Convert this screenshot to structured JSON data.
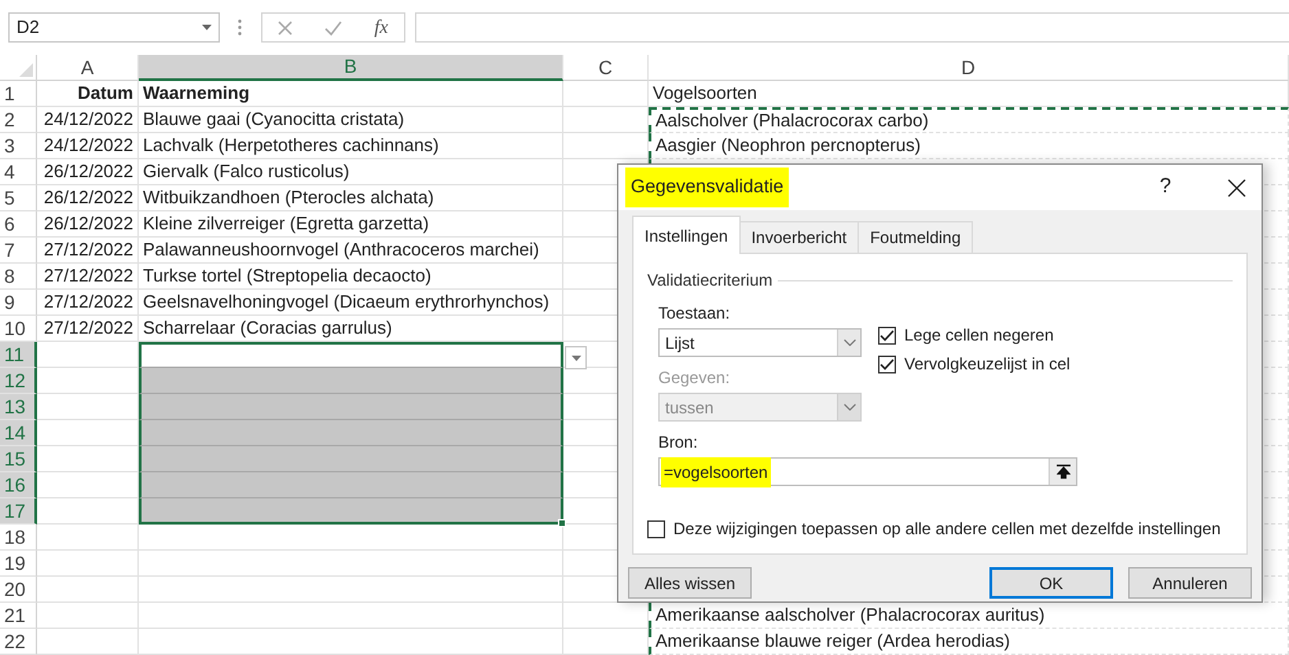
{
  "name_box": {
    "value": "D2"
  },
  "formula_bar": {
    "function_icon": "fx"
  },
  "columns": [
    {
      "label": "A",
      "selected": false
    },
    {
      "label": "B",
      "selected": true
    },
    {
      "label": "C",
      "selected": false
    },
    {
      "label": "D",
      "selected": false
    }
  ],
  "validation_dropdown": true,
  "rows": [
    {
      "number": "1",
      "selected": false,
      "cells": [
        {
          "selected": false,
          "active": false,
          "in_copy_range": false,
          "text": "Datum",
          "bold": true,
          "kind": "date"
        },
        {
          "selected": false,
          "active": false,
          "in_copy_range": false,
          "text": "Waarneming",
          "bold": true,
          "kind": "text"
        },
        {
          "selected": false,
          "active": false,
          "in_copy_range": false
        },
        {
          "selected": false,
          "active": false,
          "in_copy_range": false,
          "text": "Vogelsoorten",
          "bold": false,
          "kind": "text"
        }
      ]
    },
    {
      "number": "2",
      "selected": false,
      "cells": [
        {
          "selected": false,
          "active": false,
          "in_copy_range": false,
          "text": "24/12/2022",
          "bold": false,
          "kind": "date"
        },
        {
          "selected": false,
          "active": false,
          "in_copy_range": false,
          "text": "Blauwe gaai (Cyanocitta cristata)",
          "bold": false,
          "kind": "text"
        },
        {
          "selected": false,
          "active": false,
          "in_copy_range": false
        },
        {
          "selected": false,
          "active": false,
          "in_copy_range": true,
          "text": "Aalscholver (Phalacrocorax carbo)",
          "bold": false,
          "kind": "text"
        }
      ]
    },
    {
      "number": "3",
      "selected": false,
      "cells": [
        {
          "selected": false,
          "active": false,
          "in_copy_range": false,
          "text": "24/12/2022",
          "bold": false,
          "kind": "date"
        },
        {
          "selected": false,
          "active": false,
          "in_copy_range": false,
          "text": "Lachvalk (Herpetotheres cachinnans)",
          "bold": false,
          "kind": "text"
        },
        {
          "selected": false,
          "active": false,
          "in_copy_range": false
        },
        {
          "selected": false,
          "active": false,
          "in_copy_range": true,
          "text": "Aasgier (Neophron percnopterus)",
          "bold": false,
          "kind": "text"
        }
      ]
    },
    {
      "number": "4",
      "selected": false,
      "cells": [
        {
          "selected": false,
          "active": false,
          "in_copy_range": false,
          "text": "26/12/2022",
          "bold": false,
          "kind": "date"
        },
        {
          "selected": false,
          "active": false,
          "in_copy_range": false,
          "text": "Giervalk (Falco rusticolus)",
          "bold": false,
          "kind": "text"
        },
        {
          "selected": false,
          "active": false,
          "in_copy_range": false
        },
        {
          "selected": false,
          "active": false,
          "in_copy_range": true
        }
      ]
    },
    {
      "number": "5",
      "selected": false,
      "cells": [
        {
          "selected": false,
          "active": false,
          "in_copy_range": false,
          "text": "26/12/2022",
          "bold": false,
          "kind": "date"
        },
        {
          "selected": false,
          "active": false,
          "in_copy_range": false,
          "text": "Witbuikzandhoen (Pterocles alchata)",
          "bold": false,
          "kind": "text"
        },
        {
          "selected": false,
          "active": false,
          "in_copy_range": false
        },
        {
          "selected": false,
          "active": false,
          "in_copy_range": true
        }
      ]
    },
    {
      "number": "6",
      "selected": false,
      "cells": [
        {
          "selected": false,
          "active": false,
          "in_copy_range": false,
          "text": "26/12/2022",
          "bold": false,
          "kind": "date"
        },
        {
          "selected": false,
          "active": false,
          "in_copy_range": false,
          "text": "Kleine zilverreiger (Egretta garzetta)",
          "bold": false,
          "kind": "text"
        },
        {
          "selected": false,
          "active": false,
          "in_copy_range": false
        },
        {
          "selected": false,
          "active": false,
          "in_copy_range": true
        }
      ]
    },
    {
      "number": "7",
      "selected": false,
      "cells": [
        {
          "selected": false,
          "active": false,
          "in_copy_range": false,
          "text": "27/12/2022",
          "bold": false,
          "kind": "date"
        },
        {
          "selected": false,
          "active": false,
          "in_copy_range": false,
          "text": "Palawanneushoornvogel (Anthracoceros marchei)",
          "bold": false,
          "kind": "text"
        },
        {
          "selected": false,
          "active": false,
          "in_copy_range": false
        },
        {
          "selected": false,
          "active": false,
          "in_copy_range": true
        }
      ]
    },
    {
      "number": "8",
      "selected": false,
      "cells": [
        {
          "selected": false,
          "active": false,
          "in_copy_range": false,
          "text": "27/12/2022",
          "bold": false,
          "kind": "date"
        },
        {
          "selected": false,
          "active": false,
          "in_copy_range": false,
          "text": "Turkse tortel (Streptopelia decaocto)",
          "bold": false,
          "kind": "text"
        },
        {
          "selected": false,
          "active": false,
          "in_copy_range": false
        },
        {
          "selected": false,
          "active": false,
          "in_copy_range": true
        }
      ]
    },
    {
      "number": "9",
      "selected": false,
      "cells": [
        {
          "selected": false,
          "active": false,
          "in_copy_range": false,
          "text": "27/12/2022",
          "bold": false,
          "kind": "date"
        },
        {
          "selected": false,
          "active": false,
          "in_copy_range": false,
          "text": "Geelsnavelhoningvogel (Dicaeum erythrorhynchos)",
          "bold": false,
          "kind": "text"
        },
        {
          "selected": false,
          "active": false,
          "in_copy_range": false
        },
        {
          "selected": false,
          "active": false,
          "in_copy_range": true
        }
      ]
    },
    {
      "number": "10",
      "selected": false,
      "cells": [
        {
          "selected": false,
          "active": false,
          "in_copy_range": false,
          "text": "27/12/2022",
          "bold": false,
          "kind": "date"
        },
        {
          "selected": false,
          "active": false,
          "in_copy_range": false,
          "text": "Scharrelaar (Coracias garrulus)",
          "bold": false,
          "kind": "text"
        },
        {
          "selected": false,
          "active": false,
          "in_copy_range": false
        },
        {
          "selected": false,
          "active": false,
          "in_copy_range": true
        }
      ]
    },
    {
      "number": "11",
      "selected": true,
      "cells": [
        {
          "selected": false,
          "active": false,
          "in_copy_range": false
        },
        {
          "selected": true,
          "active": true,
          "in_copy_range": false
        },
        {
          "selected": false,
          "active": false,
          "in_copy_range": false
        },
        {
          "selected": false,
          "active": false,
          "in_copy_range": true
        }
      ]
    },
    {
      "number": "12",
      "selected": true,
      "cells": [
        {
          "selected": false,
          "active": false,
          "in_copy_range": false
        },
        {
          "selected": true,
          "active": false,
          "in_copy_range": false
        },
        {
          "selected": false,
          "active": false,
          "in_copy_range": false
        },
        {
          "selected": false,
          "active": false,
          "in_copy_range": true
        }
      ]
    },
    {
      "number": "13",
      "selected": true,
      "cells": [
        {
          "selected": false,
          "active": false,
          "in_copy_range": false
        },
        {
          "selected": true,
          "active": false,
          "in_copy_range": false
        },
        {
          "selected": false,
          "active": false,
          "in_copy_range": false
        },
        {
          "selected": false,
          "active": false,
          "in_copy_range": true
        }
      ]
    },
    {
      "number": "14",
      "selected": true,
      "cells": [
        {
          "selected": false,
          "active": false,
          "in_copy_range": false
        },
        {
          "selected": true,
          "active": false,
          "in_copy_range": false
        },
        {
          "selected": false,
          "active": false,
          "in_copy_range": false
        },
        {
          "selected": false,
          "active": false,
          "in_copy_range": true
        }
      ]
    },
    {
      "number": "15",
      "selected": true,
      "cells": [
        {
          "selected": false,
          "active": false,
          "in_copy_range": false
        },
        {
          "selected": true,
          "active": false,
          "in_copy_range": false
        },
        {
          "selected": false,
          "active": false,
          "in_copy_range": false
        },
        {
          "selected": false,
          "active": false,
          "in_copy_range": true
        }
      ]
    },
    {
      "number": "16",
      "selected": true,
      "cells": [
        {
          "selected": false,
          "active": false,
          "in_copy_range": false
        },
        {
          "selected": true,
          "active": false,
          "in_copy_range": false
        },
        {
          "selected": false,
          "active": false,
          "in_copy_range": false
        },
        {
          "selected": false,
          "active": false,
          "in_copy_range": true
        }
      ]
    },
    {
      "number": "17",
      "selected": true,
      "cells": [
        {
          "selected": false,
          "active": false,
          "in_copy_range": false
        },
        {
          "selected": true,
          "active": false,
          "in_copy_range": false
        },
        {
          "selected": false,
          "active": false,
          "in_copy_range": false
        },
        {
          "selected": false,
          "active": false,
          "in_copy_range": true
        }
      ]
    },
    {
      "number": "18",
      "selected": false,
      "cells": [
        {
          "selected": false,
          "active": false,
          "in_copy_range": false
        },
        {
          "selected": false,
          "active": false,
          "in_copy_range": false
        },
        {
          "selected": false,
          "active": false,
          "in_copy_range": false
        },
        {
          "selected": false,
          "active": false,
          "in_copy_range": true
        }
      ]
    },
    {
      "number": "19",
      "selected": false,
      "cells": [
        {
          "selected": false,
          "active": false,
          "in_copy_range": false
        },
        {
          "selected": false,
          "active": false,
          "in_copy_range": false
        },
        {
          "selected": false,
          "active": false,
          "in_copy_range": false
        },
        {
          "selected": false,
          "active": false,
          "in_copy_range": true
        }
      ]
    },
    {
      "number": "20",
      "selected": false,
      "cells": [
        {
          "selected": false,
          "active": false,
          "in_copy_range": false
        },
        {
          "selected": false,
          "active": false,
          "in_copy_range": false
        },
        {
          "selected": false,
          "active": false,
          "in_copy_range": false
        },
        {
          "selected": false,
          "active": false,
          "in_copy_range": true
        }
      ]
    },
    {
      "number": "21",
      "selected": false,
      "cells": [
        {
          "selected": false,
          "active": false,
          "in_copy_range": false
        },
        {
          "selected": false,
          "active": false,
          "in_copy_range": false
        },
        {
          "selected": false,
          "active": false,
          "in_copy_range": false
        },
        {
          "selected": false,
          "active": false,
          "in_copy_range": true,
          "text": "Amerikaanse aalscholver (Phalacrocorax auritus)",
          "bold": false,
          "kind": "text"
        }
      ]
    },
    {
      "number": "22",
      "selected": false,
      "cells": [
        {
          "selected": false,
          "active": false,
          "in_copy_range": false
        },
        {
          "selected": false,
          "active": false,
          "in_copy_range": false
        },
        {
          "selected": false,
          "active": false,
          "in_copy_range": false
        },
        {
          "selected": false,
          "active": false,
          "in_copy_range": true,
          "text": "Amerikaanse blauwe reiger (Ardea herodias)",
          "bold": false,
          "kind": "text"
        }
      ]
    }
  ],
  "dialog": {
    "title": "Gegevensvalidatie",
    "title_highlighted": true,
    "help": "?",
    "tabs": [
      {
        "label": "Instellingen",
        "selected": true
      },
      {
        "label": "Invoerbericht",
        "selected": false
      },
      {
        "label": "Foutmelding",
        "selected": false
      }
    ],
    "group": "Validatiecriterium",
    "allow": {
      "label": "Toestaan:",
      "value": "Lijst",
      "disabled": false
    },
    "data": {
      "label": "Gegeven:",
      "value": "tussen",
      "disabled": true
    },
    "options": [
      {
        "label": "Lege cellen negeren",
        "checked": true
      },
      {
        "label": "Vervolgkeuzelijst in cel",
        "checked": true
      }
    ],
    "source": {
      "label": "Bron:",
      "value": "=vogelsoorten",
      "highlighted": true
    },
    "apply_all": {
      "label": "Deze wijzigingen toepassen op alle andere cellen met dezelfde instellingen",
      "checked": false
    },
    "buttons": [
      {
        "label": "Alles wissen",
        "kind": "secondary"
      },
      {
        "label": "OK",
        "kind": "default"
      },
      {
        "label": "Annuleren",
        "kind": "secondary"
      }
    ]
  }
}
